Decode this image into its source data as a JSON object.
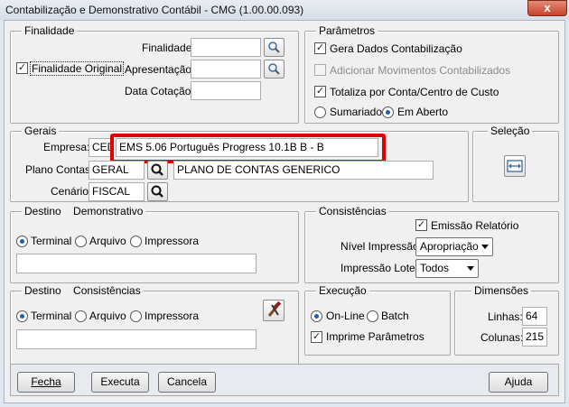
{
  "window": {
    "title": "Contabilização e Demonstrativo Contábil - CMG (1.00.00.093)",
    "close": "x"
  },
  "finalidade": {
    "legend": "Finalidade",
    "finalidade_label": "Finalidade",
    "finalidade_value": "",
    "apresentacao_label": "Apresentação",
    "apresentacao_value": "",
    "data_cotacao_label": "Data Cotação",
    "data_cotacao_value": "",
    "original_label": "Finalidade Original",
    "original_checked": true
  },
  "parametros": {
    "legend": "Parâmetros",
    "gera_label": "Gera Dados Contabilização",
    "adicionar_label": "Adicionar Movimentos Contabilizados",
    "totaliza_label": "Totaliza por Conta/Centro de Custo",
    "sumariado_label": "Sumariado",
    "em_aberto_label": "Em Aberto"
  },
  "gerais": {
    "legend": "Gerais",
    "empresa_label": "Empresa:",
    "empresa_code": "CED",
    "empresa_desc": "EMS 5.06 Português Progress 10.1B B - B",
    "plano_label": "Plano Contas:",
    "plano_code": "GERAL",
    "plano_desc": "PLANO DE CONTAS GENERICO",
    "cenario_label": "Cenário:",
    "cenario_code": "FISCAL"
  },
  "selecao": {
    "legend": "Seleção"
  },
  "destino_demo": {
    "legend": "Destino    Demonstrativo",
    "terminal": "Terminal",
    "arquivo": "Arquivo",
    "impressora": "Impressora",
    "path": ""
  },
  "consistencias": {
    "legend": "Consistências",
    "emissao_label": "Emissão Relatório",
    "nivel_label": "Nível Impressão:",
    "nivel_value": "Apropriação",
    "lotes_label": "Impressão Lotes:",
    "lotes_value": "Todos"
  },
  "destino_cons": {
    "legend": "Destino    Consistências",
    "terminal": "Terminal",
    "arquivo": "Arquivo",
    "impressora": "Impressora",
    "path": ""
  },
  "execucao": {
    "legend": "Execução",
    "online": "On-Line",
    "batch": "Batch",
    "imprime_label": "Imprime Parâmetros"
  },
  "dimensoes": {
    "legend": "Dimensões",
    "linhas_label": "Linhas:",
    "linhas_value": "64",
    "colunas_label": "Colunas:",
    "colunas_value": "215"
  },
  "footer": {
    "fecha": "Fecha",
    "executa": "Executa",
    "cancela": "Cancela",
    "ajuda": "Ajuda"
  }
}
